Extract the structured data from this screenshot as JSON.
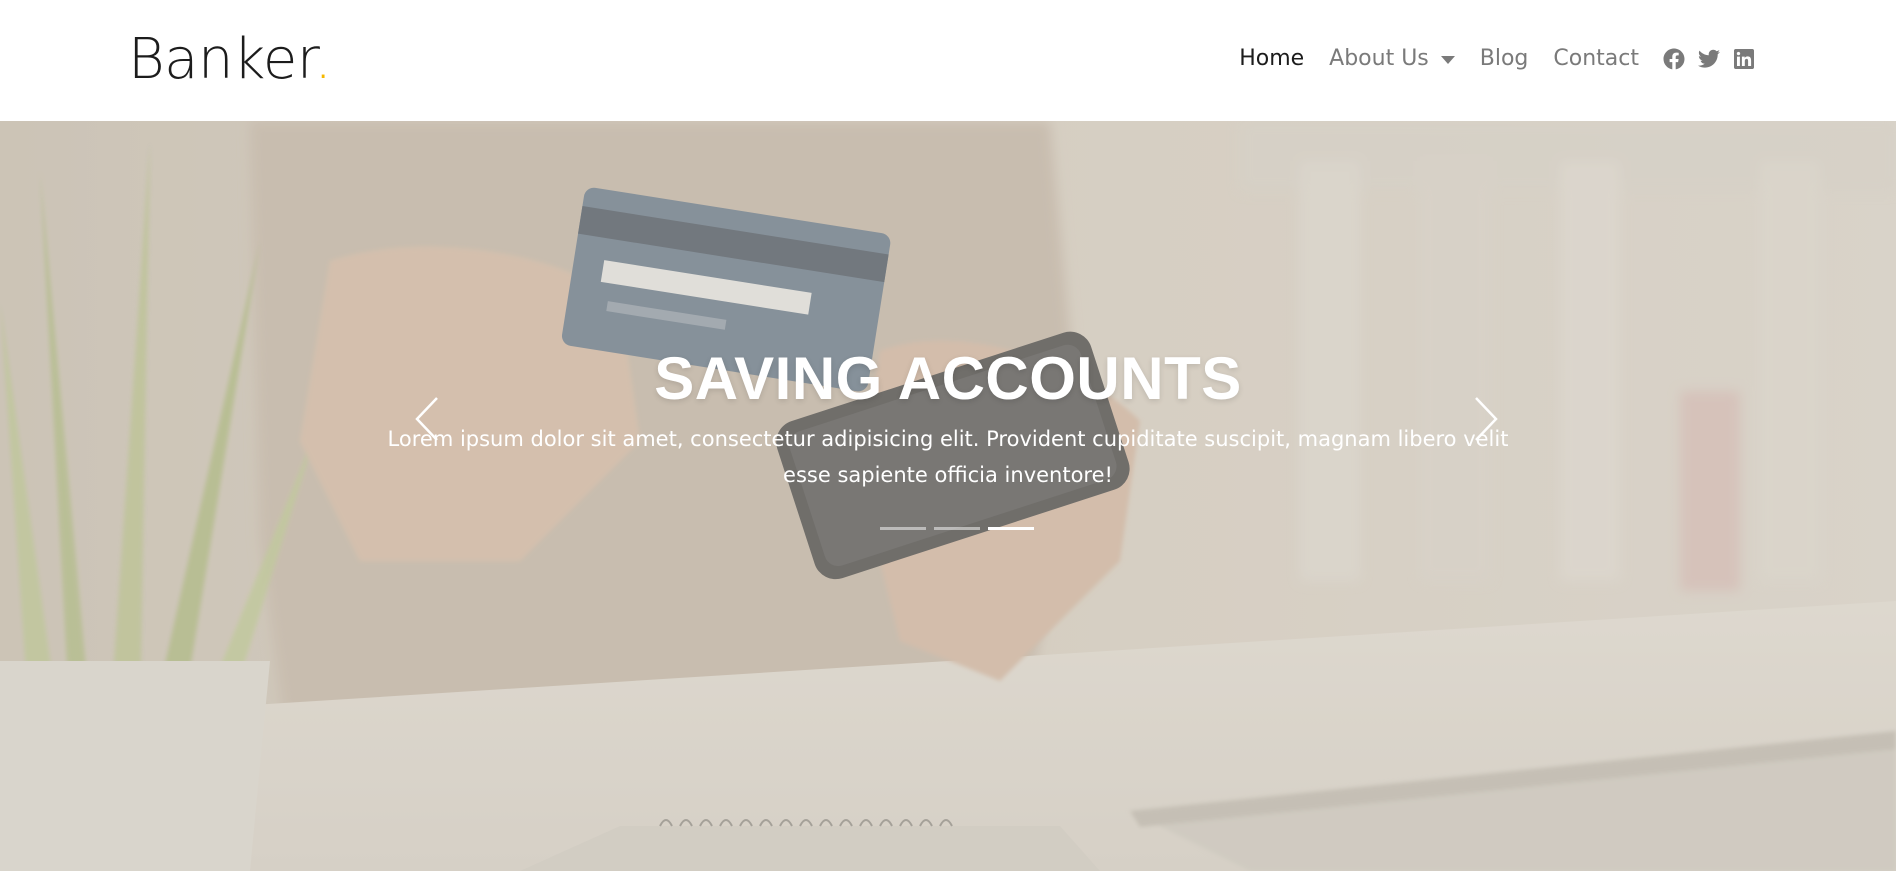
{
  "brand": {
    "name": "Banker",
    "dot": ".",
    "dot_color": "#f5b800"
  },
  "nav": {
    "home": "Home",
    "about": "About Us",
    "blog": "Blog",
    "contact": "Contact",
    "social_icons": [
      "facebook-icon",
      "twitter-icon",
      "linkedin-icon"
    ]
  },
  "hero": {
    "title": "SAVING ACCOUNTS",
    "text": "Lorem ipsum dolor sit amet, consectetur adipisicing elit. Provident cupiditate suscipit, magnam libero velit esse sapiente officia inventore!",
    "slide_count": 3,
    "active_slide": 3,
    "prev_icon": "chevron-left-icon",
    "next_icon": "chevron-right-icon"
  },
  "colors": {
    "text_dark": "#1c1c1c",
    "nav_muted": "#7a7a7a",
    "accent": "#f5b800"
  }
}
